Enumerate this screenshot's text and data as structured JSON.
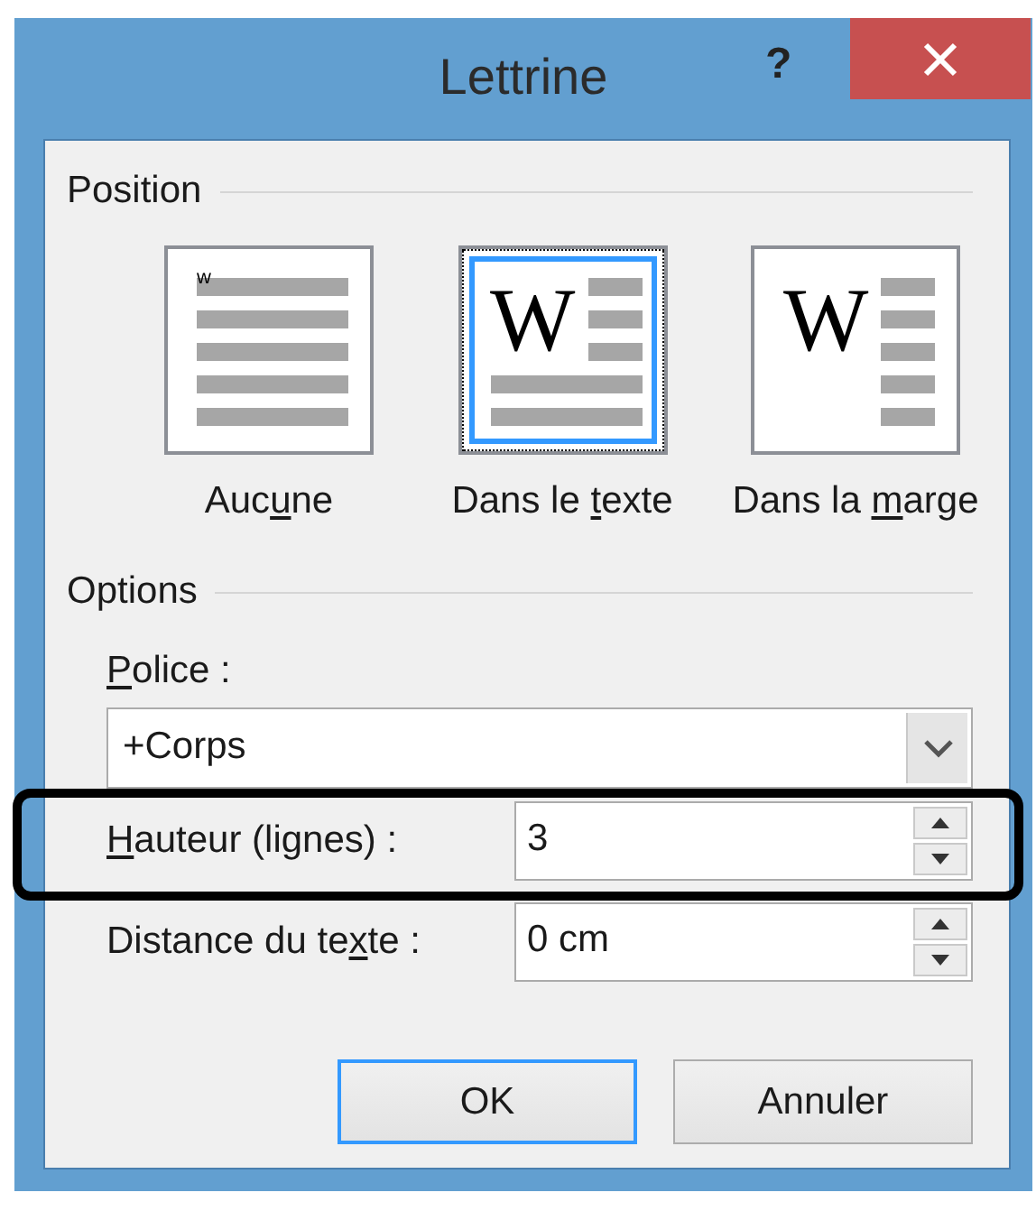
{
  "window": {
    "title": "Lettrine",
    "help": "?"
  },
  "position": {
    "heading": "Position",
    "options": [
      {
        "kind": "none",
        "letter": "w",
        "label": {
          "before": "Auc",
          "key": "u",
          "after": "ne"
        },
        "selected": false
      },
      {
        "kind": "in_text",
        "letter": "W",
        "label": {
          "before": "Dans le ",
          "key": "t",
          "after": "exte"
        },
        "selected": true
      },
      {
        "kind": "in_margin",
        "letter": "W",
        "label": {
          "before": "Dans la ",
          "key": "m",
          "after": "arge"
        },
        "selected": false
      }
    ]
  },
  "options": {
    "heading": "Options",
    "font": {
      "label": {
        "key": "P",
        "after": "olice :"
      },
      "value": "+Corps"
    },
    "fields": [
      {
        "label": {
          "key": "H",
          "after": "auteur (lignes) :"
        },
        "value": "3",
        "highlighted": true
      },
      {
        "label": {
          "before": "Distance du te",
          "key": "x",
          "after": "te :"
        },
        "value": "0 cm",
        "highlighted": false
      }
    ]
  },
  "buttons": [
    {
      "label": "OK",
      "default": true
    },
    {
      "label": "Annuler",
      "default": false
    }
  ]
}
